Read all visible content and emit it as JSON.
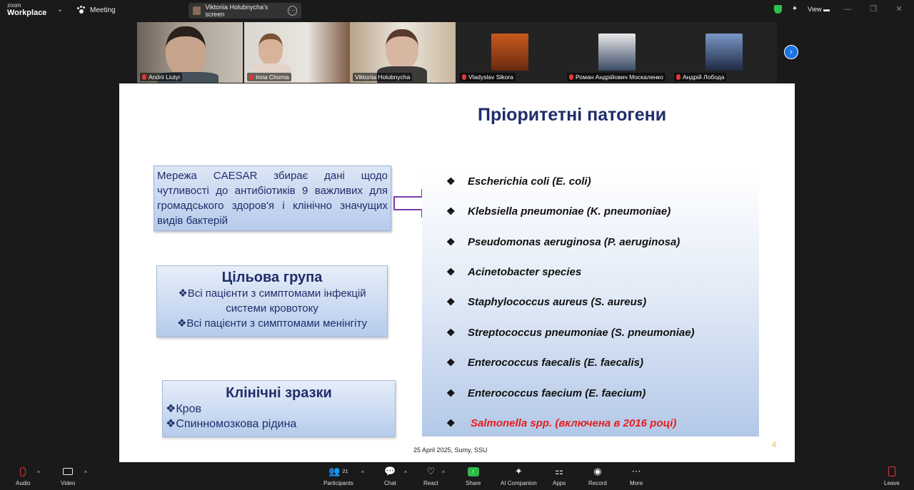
{
  "app": {
    "brand_small": "zoom",
    "brand": "Workplace",
    "meeting_label": "Meeting"
  },
  "screen_share": {
    "label": "Viktoriia Holubnycha's screen"
  },
  "view_label": "View",
  "participants": [
    {
      "name": "Andrii Liutyi"
    },
    {
      "name": "Inna Chorna"
    },
    {
      "name": "Viktoriia Holubnycha"
    },
    {
      "name": "Vladyslav Sikora"
    },
    {
      "name": "Роман Андрійович Москаленко"
    },
    {
      "name": "Андрій Лобода"
    }
  ],
  "slide": {
    "title": "Пріоритетні патогени",
    "caesar_text": "Мережа CAESAR збирає дані щодо чутливості до антибіотиків 9 важливих для громадського здоров'я і клінічно значущих видів бактерій",
    "target_group": {
      "heading": "Цільова група",
      "line1": "❖Всі пацієнти з симптомами інфекцій",
      "line2": "системи кровотоку",
      "line3": "❖Всі пацієнти з симптомами менінгіту"
    },
    "samples": {
      "heading": "Клінічні зразки",
      "line1": "❖Кров",
      "line2": "❖Спинномозкова рідина"
    },
    "bullet": "❖",
    "pathogens": [
      "Escherichia coli (E. coli)",
      "Klebsiella pneumoniae (K. pneumoniae)",
      "Pseudomonas aeruginosa (P. aeruginosa)",
      "Acinetobacter species",
      "Staphylococcus aureus (S. aureus)",
      "Streptococcus pneumoniae (S. pneumoniae)",
      "Enterococcus faecalis (E. faecalis)",
      "Enterococcus faecium (E. faecium)"
    ],
    "pathogen_red": "Salmonella spp. (включена в 2016 році)",
    "footer": "25 April 2025,  Sumy, SSU",
    "page_number": "4"
  },
  "toolbar": {
    "audio": "Audio",
    "video": "Video",
    "participants": "Participants",
    "participants_count": "21",
    "chat": "Chat",
    "react": "React",
    "share": "Share",
    "ai": "AI Companion",
    "apps": "Apps",
    "record": "Record",
    "more": "More",
    "leave": "Leave"
  },
  "colors": {
    "accent_green": "#2fb84a",
    "mute_red": "#e0363b",
    "slide_navy": "#1f2d6b",
    "red_text": "#e81c1c"
  }
}
